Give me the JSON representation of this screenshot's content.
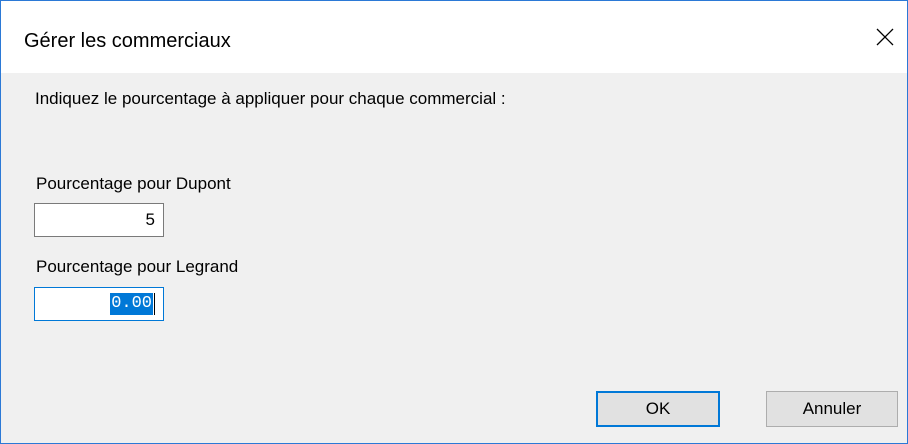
{
  "window": {
    "title": "Gérer les commerciaux",
    "close_icon": "close-icon"
  },
  "dialog": {
    "instruction": "Indiquez le pourcentage à appliquer pour chaque commercial :",
    "fields": [
      {
        "label": "Pourcentage pour Dupont",
        "value": "5"
      },
      {
        "label": "Pourcentage pour Legrand",
        "value": "0.00",
        "selected": true,
        "focused": true
      }
    ],
    "ok_label": "OK",
    "cancel_label": "Annuler"
  },
  "colors": {
    "accent": "#0078d7",
    "window_border": "#2b79d6",
    "dialog_background": "#f0f0f0",
    "button_background": "#e1e1e1"
  }
}
